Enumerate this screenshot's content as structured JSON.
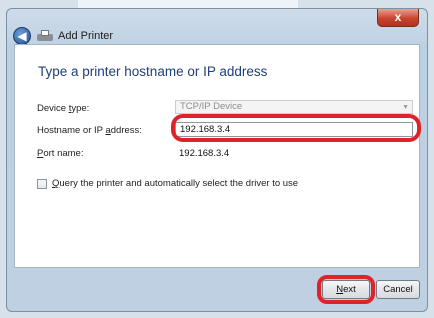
{
  "window": {
    "title": "Add Printer",
    "close_glyph": "x",
    "back_glyph": "◀"
  },
  "page": {
    "heading": "Type a printer hostname or IP address"
  },
  "form": {
    "device_type": {
      "label": "Device type:",
      "value": "TCP/IP Device"
    },
    "hostname": {
      "label": "Hostname or IP address:",
      "value": "192.168.3.4"
    },
    "port_name": {
      "label": "Port name:",
      "value": "192.168.3.4"
    },
    "query_checkbox": {
      "label": "Query the printer and automatically select the driver to use",
      "checked": false
    }
  },
  "buttons": {
    "next": "Next",
    "cancel": "Cancel"
  },
  "icons": {
    "back": "back-arrow-icon",
    "printer": "printer-icon",
    "dropdown": "chevron-down-icon"
  },
  "colors": {
    "highlight": "#e0232b",
    "heading": "#1f3f7a",
    "close_button": "#c7452f"
  }
}
